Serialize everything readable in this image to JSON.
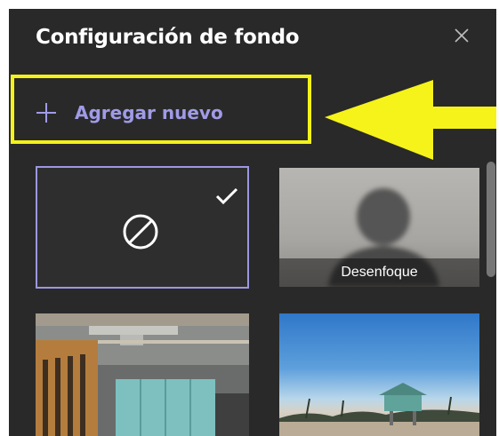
{
  "panel": {
    "title": "Configuración de fondo",
    "close_icon": "close-icon"
  },
  "add_new": {
    "label": "Agregar nuevo",
    "icon": "plus-icon"
  },
  "annotation": {
    "highlight_color": "#f3f21a",
    "arrow_icon": "arrow-left-icon"
  },
  "backgrounds": {
    "none": {
      "icon": "no-background-icon",
      "selected": true,
      "check_icon": "checkmark-icon"
    },
    "blur": {
      "label": "Desenfoque"
    },
    "office": {
      "type": "image"
    },
    "beach": {
      "type": "image"
    }
  },
  "colors": {
    "panel_bg": "#292929",
    "accent": "#a09be6",
    "selected_border": "#9c97e0"
  }
}
